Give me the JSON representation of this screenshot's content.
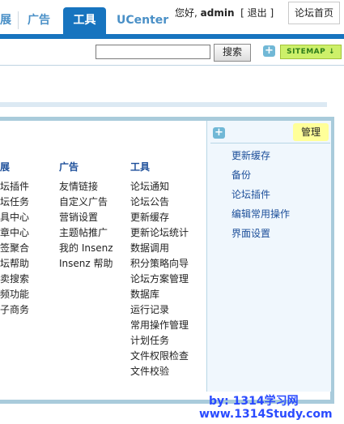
{
  "nav": {
    "tabs": [
      {
        "label": "展"
      },
      {
        "label": "广告"
      },
      {
        "label": "工具"
      },
      {
        "label": "UCenter"
      }
    ],
    "welcome": "您好,",
    "username": "admin",
    "logout": "[ 退出 ]",
    "forum_home": "论坛首页"
  },
  "toolbar": {
    "search_value": "",
    "search_button": "搜索",
    "sitemap": "SITEMAP ↓"
  },
  "columns": [
    {
      "title": "展",
      "items": [
        "坛插件",
        "坛任务",
        "具中心",
        "章中心",
        "签聚合",
        "坛帮助",
        "卖搜索",
        "频功能",
        "子商务"
      ]
    },
    {
      "title": "广告",
      "items": [
        "友情链接",
        "自定义广告",
        "营销设置",
        "主题帖推广",
        "我的 Insenz",
        "Insenz 帮助"
      ]
    },
    {
      "title": "工具",
      "items": [
        "论坛通知",
        "论坛公告",
        "更新缓存",
        "更新论坛统计",
        "数据调用",
        "积分策略向导",
        "论坛方案管理",
        "数据库",
        "运行记录",
        "常用操作管理",
        "计划任务",
        "文件权限检查",
        "文件校验"
      ]
    }
  ],
  "sidebar": {
    "title": "管理",
    "items": [
      "更新缓存",
      "备份",
      "论坛插件",
      "编辑常用操作",
      "界面设置"
    ]
  },
  "watermark": {
    "line1": "by: 1314学习网",
    "line2": "www.1314Study.com"
  }
}
